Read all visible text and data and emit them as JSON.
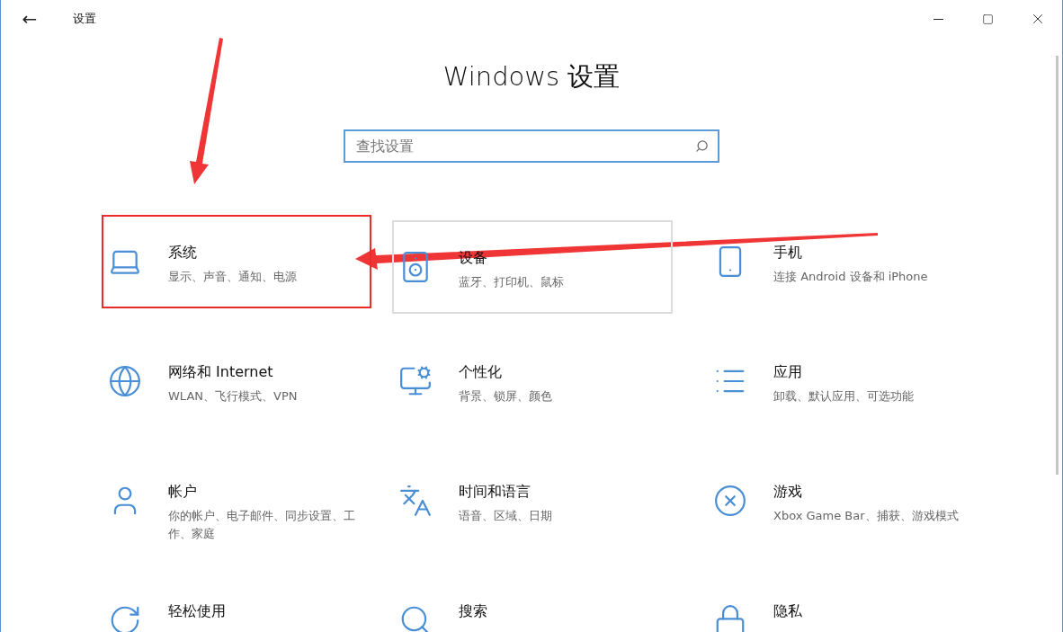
{
  "window": {
    "title": "设置",
    "back": "←"
  },
  "heading": "Windows 设置",
  "search": {
    "placeholder": "查找设置"
  },
  "tiles": [
    {
      "title": "系统",
      "description": "显示、声音、通知、电源",
      "highlighted": true,
      "hovered": false
    },
    {
      "title": "设备",
      "description": "蓝牙、打印机、鼠标",
      "highlighted": false,
      "hovered": true
    },
    {
      "title": "手机",
      "description": "连接 Android 设备和 iPhone",
      "highlighted": false,
      "hovered": false
    },
    {
      "title": "网络和 Internet",
      "description": "WLAN、飞行模式、VPN",
      "highlighted": false,
      "hovered": false
    },
    {
      "title": "个性化",
      "description": "背景、锁屏、颜色",
      "highlighted": false,
      "hovered": false
    },
    {
      "title": "应用",
      "description": "卸载、默认应用、可选功能",
      "highlighted": false,
      "hovered": false
    },
    {
      "title": "帐户",
      "description": "你的帐户、电子邮件、同步设置、工作、家庭",
      "highlighted": false,
      "hovered": false
    },
    {
      "title": "时间和语言",
      "description": "语音、区域、日期",
      "highlighted": false,
      "hovered": false
    },
    {
      "title": "游戏",
      "description": "Xbox Game Bar、捕获、游戏模式",
      "highlighted": false,
      "hovered": false
    },
    {
      "title": "轻松使用",
      "highlighted": false,
      "hovered": false
    },
    {
      "title": "搜索",
      "highlighted": false,
      "hovered": false
    },
    {
      "title": "隐私",
      "highlighted": false,
      "hovered": false
    }
  ]
}
